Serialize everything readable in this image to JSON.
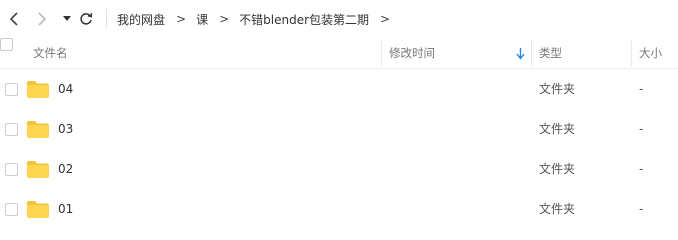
{
  "nav": {
    "back_icon": "chevron-left-icon",
    "forward_icon": "chevron-right-icon",
    "history_icon": "caret-down-icon",
    "refresh_icon": "refresh-icon"
  },
  "breadcrumb": {
    "items": [
      "我的网盘",
      "课",
      "不错blender包装第二期"
    ],
    "separator": ">"
  },
  "table": {
    "columns": {
      "name": "文件名",
      "modified": "修改时间",
      "type": "类型",
      "size": "大小"
    },
    "sort_indicator": "sort-down-icon",
    "rows": [
      {
        "name": "04",
        "modified": "",
        "type": "文件夹",
        "size": "-"
      },
      {
        "name": "03",
        "modified": "",
        "type": "文件夹",
        "size": "-"
      },
      {
        "name": "02",
        "modified": "",
        "type": "文件夹",
        "size": "-"
      },
      {
        "name": "01",
        "modified": "",
        "type": "文件夹",
        "size": "-"
      }
    ]
  },
  "colors": {
    "folder": "#FFD54F",
    "folder_tab": "#F5C33B",
    "sort_arrow": "#1E88E5"
  }
}
